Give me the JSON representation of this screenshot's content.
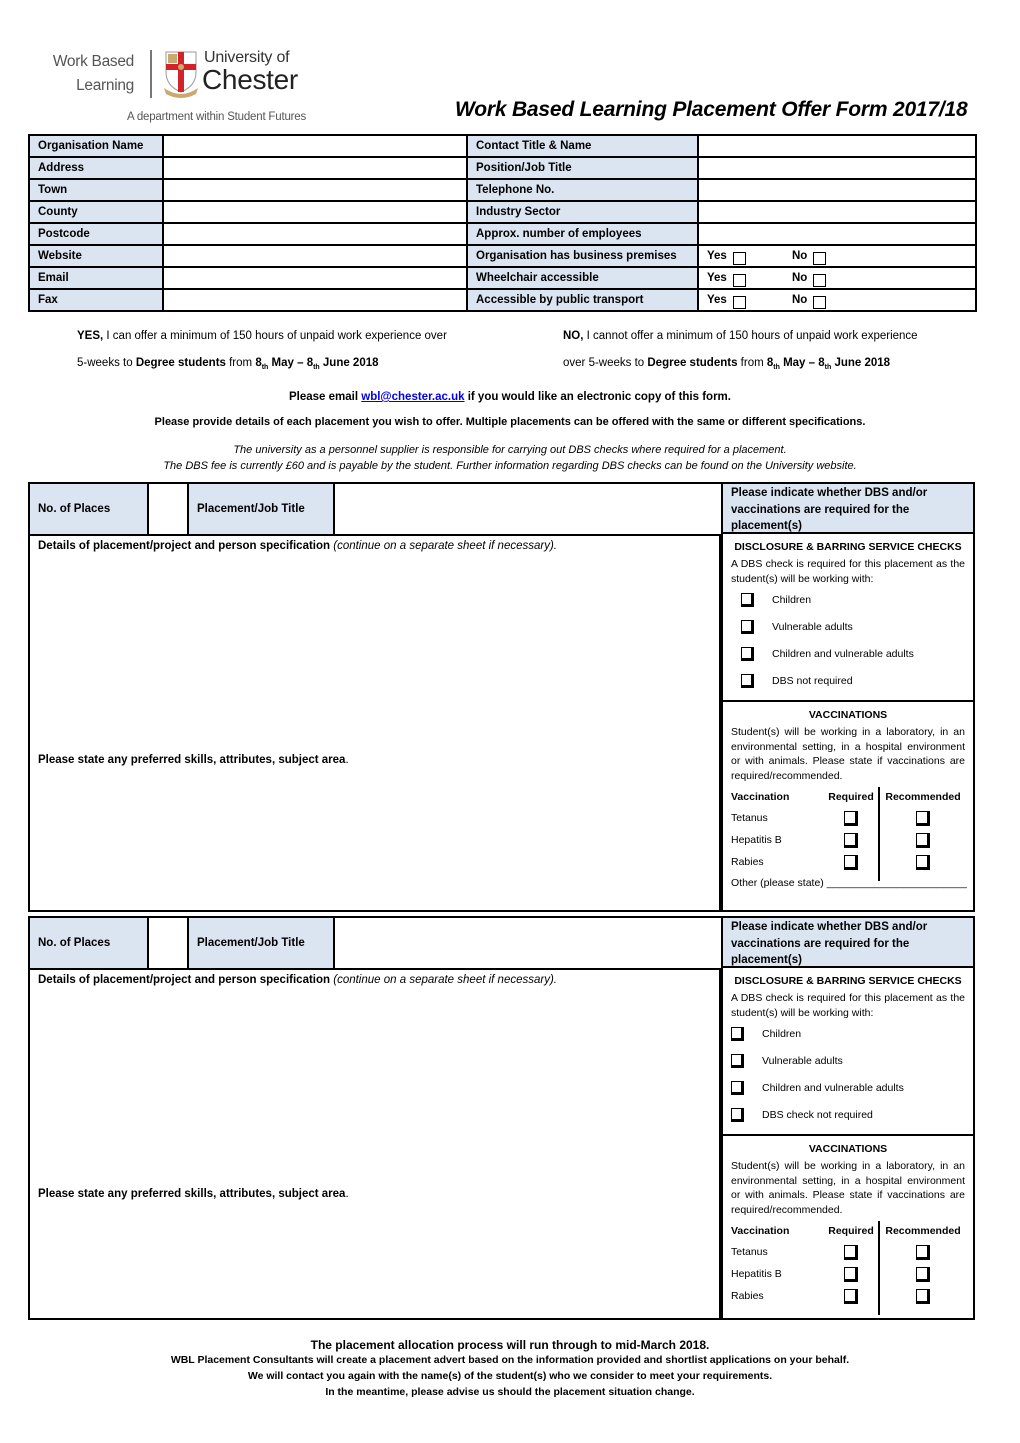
{
  "logo": {
    "left_text_line1": "Work Based",
    "left_text_line2": "Learning",
    "university_line1": "University of",
    "university_line2": "Chester",
    "tagline": "A department within Student Futures"
  },
  "title": "Work Based Learning Placement Offer Form 2017/18",
  "org_table": {
    "rows": [
      {
        "left_label": "Organisation Name",
        "left_value": "",
        "right_label": "Contact Title & Name",
        "right_value": ""
      },
      {
        "left_label": "Address",
        "left_value": "",
        "right_label": "Position/Job Title",
        "right_value": ""
      },
      {
        "left_label": "Town",
        "left_value": "",
        "right_label": "Telephone No.",
        "right_value": ""
      },
      {
        "left_label": "County",
        "left_value": "",
        "right_label": "Industry Sector",
        "right_value": ""
      },
      {
        "left_label": "Postcode",
        "left_value": "",
        "right_label": "Approx. number of employees",
        "right_value": ""
      },
      {
        "left_label": "Website",
        "left_value": "",
        "right_label": "Organisation has business premises",
        "yes_label": "Yes",
        "no_label": "No",
        "yes_checked": false,
        "no_checked": false
      },
      {
        "left_label": "Email",
        "left_value": "",
        "right_label": "Wheelchair accessible",
        "yes_label": "Yes",
        "no_label": "No",
        "yes_checked": false,
        "no_checked": false
      },
      {
        "left_label": "Fax",
        "left_value": "",
        "right_label": "Accessible by public transport",
        "yes_label": "Yes",
        "no_label": "No",
        "yes_checked": false,
        "no_checked": false
      }
    ]
  },
  "offer_yes": {
    "lead": "YES,",
    "line1_rest": " I can offer a minimum of 150 hours of unpaid work experience over",
    "line2_pre": "5-weeks to ",
    "students": "Degree students",
    "from": " from ",
    "d1": "8",
    "sup1": "th",
    "month1": " May – ",
    "d2": "8",
    "sup2": "th",
    "month2": " June 2018"
  },
  "offer_no": {
    "lead": "NO,",
    "line1_rest": " I cannot offer a minimum of 150 hours of unpaid work experience",
    "line2_pre": "over 5-weeks to ",
    "students": "Degree students",
    "from": " from ",
    "d1": "8",
    "sup1": "th",
    "month1": " May – ",
    "d2": "8",
    "sup2": "th",
    "month2": " June 2018"
  },
  "info": {
    "email_pre": "Please email ",
    "email_link": "wbl@chester.ac.uk",
    "email_post": " if you would like an electronic copy of this form.",
    "provide_details": "Please provide details of each placement you wish to offer.  Multiple placements can be offered with the same or different specifications.",
    "dbs_line1": "The university as a personnel supplier is responsible for carrying out DBS checks where required for a placement.",
    "dbs_line2": "The DBS fee is currently £60 and is payable by the student. Further information regarding DBS checks can be found on the University website."
  },
  "placements": [
    {
      "no_of_places_label": "No. of Places",
      "no_of_places_value": "",
      "job_title_label": "Placement/Job Title",
      "job_title_value": "",
      "details_label": "Details of placement/project and person specification",
      "details_note": " (continue on a separate sheet if necessary).",
      "skills_label": "Please state any preferred skills, attributes, subject area",
      "skills_suffix": ".",
      "indicate_header": "Please indicate whether DBS and/or vaccinations are required for the placement(s)",
      "dbs_title": "DISCLOSURE & BARRING SERVICE CHECKS",
      "dbs_text": "A DBS check is required for this placement as the student(s) will be working with:",
      "dbs_options": [
        {
          "label": "Children",
          "checked": false
        },
        {
          "label": "Vulnerable adults",
          "checked": false
        },
        {
          "label": "Children and vulnerable adults",
          "checked": false
        },
        {
          "label": "DBS not required",
          "checked": false
        }
      ],
      "vacc_title": "VACCINATIONS",
      "vacc_text": "Student(s) will be working in a laboratory, in an environmental setting, in a hospital environment or with animals.  Please state if vaccinations are required/recommended.",
      "vacc_headers": [
        "Vaccination",
        "Required",
        "Recommended"
      ],
      "vaccinations": [
        {
          "name": "Tetanus",
          "required": false,
          "recommended": false
        },
        {
          "name": "Hepatitis B",
          "required": false,
          "recommended": false
        },
        {
          "name": "Rabies",
          "required": false,
          "recommended": false
        }
      ],
      "other_label": "Other (please state) ________________________"
    },
    {
      "no_of_places_label": "No. of Places",
      "no_of_places_value": "",
      "job_title_label": "Placement/Job Title",
      "job_title_value": "",
      "details_label": "Details of placement/project and person specification",
      "details_note": " (continue on a separate sheet if necessary).",
      "skills_label": "Please state any preferred skills, attributes, subject area",
      "skills_suffix": ".",
      "indicate_header": "Please indicate whether DBS and/or vaccinations are required for the placement(s)",
      "dbs_title": "DISCLOSURE & BARRING SERVICE CHECKS",
      "dbs_text": "A DBS check is required for this placement as the student(s) will be working with:",
      "dbs_options": [
        {
          "label": "Children",
          "checked": false
        },
        {
          "label": "Vulnerable adults",
          "checked": false
        },
        {
          "label": "Children and vulnerable adults",
          "checked": false
        },
        {
          "label": "DBS check not required",
          "checked": false
        }
      ],
      "vacc_title": "VACCINATIONS",
      "vacc_text": "Student(s) will be working in a laboratory, in an environmental setting, in a hospital environment or with animals.  Please state if vaccinations are required/recommended.",
      "vacc_headers": [
        "Vaccination",
        "Required",
        "Recommended"
      ],
      "vaccinations": [
        {
          "name": "Tetanus",
          "required": false,
          "recommended": false
        },
        {
          "name": "Hepatitis B",
          "required": false,
          "recommended": false
        },
        {
          "name": "Rabies",
          "required": false,
          "recommended": false
        }
      ]
    }
  ],
  "footer": {
    "line1": "The placement allocation process will run through to mid-March 2018.",
    "line2": "WBL Placement Consultants will create a placement advert based on the information provided and shortlist applications on your behalf.",
    "line3": "We will contact you again with the name(s) of the student(s) who we consider to meet your requirements.",
    "line4": "In the meantime, please advise us should the placement situation change."
  },
  "colors": {
    "label_bg": "#dbe5f1",
    "link": "#0000ee",
    "crest_red": "#d2232a"
  }
}
